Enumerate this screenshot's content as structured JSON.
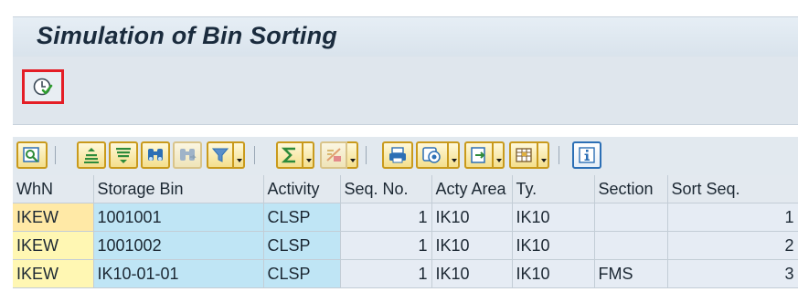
{
  "title": "Simulation of Bin Sorting",
  "toolbar_icons": [
    "details-icon",
    "sort-ascending-icon",
    "sort-descending-icon",
    "find-icon",
    "find-next-icon",
    "filter-icon",
    "total-icon",
    "subtotal-icon",
    "print-icon",
    "views-icon",
    "export-icon",
    "layout-icon",
    "information-icon"
  ],
  "columns": [
    "WhN",
    "Storage Bin",
    "Activity",
    "Seq. No.",
    "Acty Area",
    "Ty.",
    "Section",
    "Sort Seq."
  ],
  "rows": [
    {
      "whn": "IKEW",
      "bin": "1001001",
      "activity": "CLSP",
      "seq": "1",
      "area": "IK10",
      "type": "IK10",
      "section": "",
      "sort": "1"
    },
    {
      "whn": "IKEW",
      "bin": "1001002",
      "activity": "CLSP",
      "seq": "1",
      "area": "IK10",
      "type": "IK10",
      "section": "",
      "sort": "2"
    },
    {
      "whn": "IKEW",
      "bin": "IK10-01-01",
      "activity": "CLSP",
      "seq": "1",
      "area": "IK10",
      "type": "IK10",
      "section": "FMS",
      "sort": "3"
    }
  ]
}
